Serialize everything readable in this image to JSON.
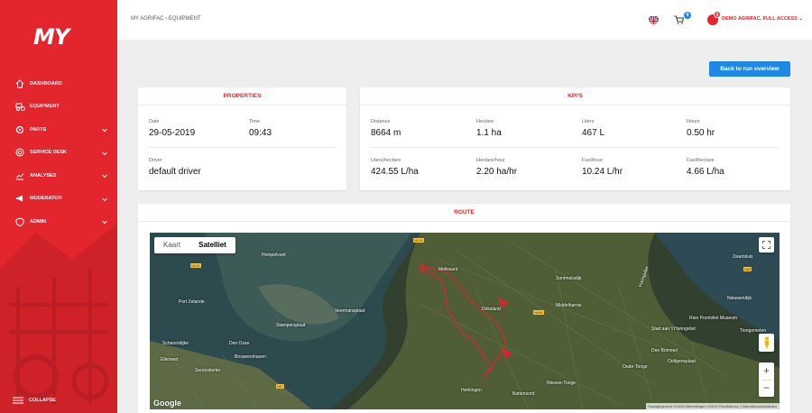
{
  "brand": {
    "logo": "MY",
    "accent": "#e3252d",
    "blue": "#1e88e5"
  },
  "sidebar": {
    "items": [
      {
        "label": "DASHBOARD",
        "icon": "home-icon",
        "has_children": false
      },
      {
        "label": "EQUIPMENT",
        "icon": "tractor-icon",
        "has_children": false
      },
      {
        "label": "PARTS",
        "icon": "gear-icon",
        "has_children": true
      },
      {
        "label": "SERVICE DESK",
        "icon": "lifebuoy-icon",
        "has_children": true
      },
      {
        "label": "ANALYSES",
        "icon": "chart-icon",
        "has_children": true
      },
      {
        "label": "MODERATOR",
        "icon": "megaphone-icon",
        "has_children": true
      },
      {
        "label": "ADMIN",
        "icon": "shield-icon",
        "has_children": true
      }
    ],
    "collapse_label": "COLLAPSE"
  },
  "header": {
    "breadcrumb": "MY AGRIFAC › EQUIPMENT",
    "cart_count": "0",
    "user_badge": "0",
    "user_label": "DEMO AGRIFAC, FULL ACCESS"
  },
  "back_button": "Back to run overview",
  "properties": {
    "title": "PROPERTIES",
    "date_label": "Date",
    "date": "29-05-2019",
    "time_label": "Time",
    "time": "09:43",
    "driver_label": "Driver",
    "driver": "default driver"
  },
  "kpis": {
    "title": "KPI'S",
    "row1": [
      {
        "label": "Distance",
        "value": "8664 m"
      },
      {
        "label": "Hectare",
        "value": "1.1 ha"
      },
      {
        "label": "Liters",
        "value": "467 L"
      },
      {
        "label": "Hours",
        "value": "0.50 hr"
      }
    ],
    "row2": [
      {
        "label": "Liters/hectare",
        "value": "424.55 L/ha"
      },
      {
        "label": "Hectare/hour",
        "value": "2.20 ha/hr"
      },
      {
        "label": "Fuel/hour",
        "value": "10.24 L/hr"
      },
      {
        "label": "Fuel/hectare",
        "value": "4.66 L/ha"
      }
    ]
  },
  "route": {
    "title": "ROUTE",
    "map_types": [
      "Kaart",
      "Satelliet"
    ],
    "active_map_type": "Satelliet",
    "google": "Google",
    "attribution": "Kaartgegevens ©2019 Afbeeldingen ©2019 TerraMetrics | Gebruiksvoorwaarden",
    "places": [
      "Hompelvoet",
      "Melissant",
      "Dirksland",
      "Middelharnis",
      "Sommelsdijk",
      "Port Zelande",
      "Stampersplaat",
      "Veermansplaat",
      "Scharendijke",
      "Den Osse",
      "Brouwershaven",
      "Ellemeet",
      "Serooskerke",
      "Herkingen",
      "Battenoord",
      "Nieuwe-Tonge",
      "Zwartsluis",
      "Nieuwendijk",
      "Rien Poortvliet Museum",
      "Tiengemeten",
      "Stad aan 't Haringvliet",
      "Den Bommel",
      "Ooltgensplaat",
      "Oude-Tonge",
      "Haringvliet"
    ],
    "roads": [
      "N215",
      "N215",
      "N498",
      "N57",
      "N59"
    ],
    "zoom_in": "+",
    "zoom_out": "−"
  }
}
